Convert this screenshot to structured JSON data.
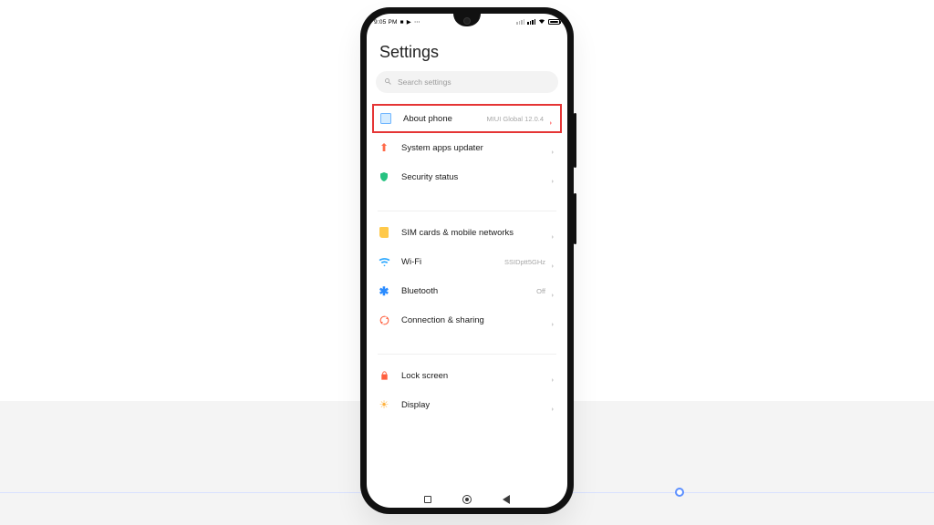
{
  "status_bar": {
    "time": "9:05 PM",
    "left_icons": [
      "video",
      "record",
      "more"
    ],
    "right_icons": [
      "signal-dim",
      "signal",
      "wifi",
      "battery"
    ]
  },
  "title": "Settings",
  "search": {
    "placeholder": "Search settings"
  },
  "groups": [
    {
      "items": [
        {
          "icon": "about-icon",
          "label": "About phone",
          "value": "MIUI Global 12.0.4",
          "highlight": true
        },
        {
          "icon": "updater-icon",
          "label": "System apps updater",
          "value": ""
        },
        {
          "icon": "shield-icon",
          "label": "Security status",
          "value": ""
        }
      ]
    },
    {
      "items": [
        {
          "icon": "sim-icon",
          "label": "SIM cards & mobile networks",
          "value": ""
        },
        {
          "icon": "wifi-icon",
          "label": "Wi-Fi",
          "value": "SSIDptt5GHz"
        },
        {
          "icon": "bt-icon",
          "label": "Bluetooth",
          "value": "Off"
        },
        {
          "icon": "share-icon",
          "label": "Connection & sharing",
          "value": ""
        }
      ]
    },
    {
      "items": [
        {
          "icon": "lock-icon",
          "label": "Lock screen",
          "value": ""
        },
        {
          "icon": "display-icon",
          "label": "Display",
          "value": ""
        }
      ]
    }
  ],
  "nav": [
    "recents",
    "home",
    "back"
  ]
}
